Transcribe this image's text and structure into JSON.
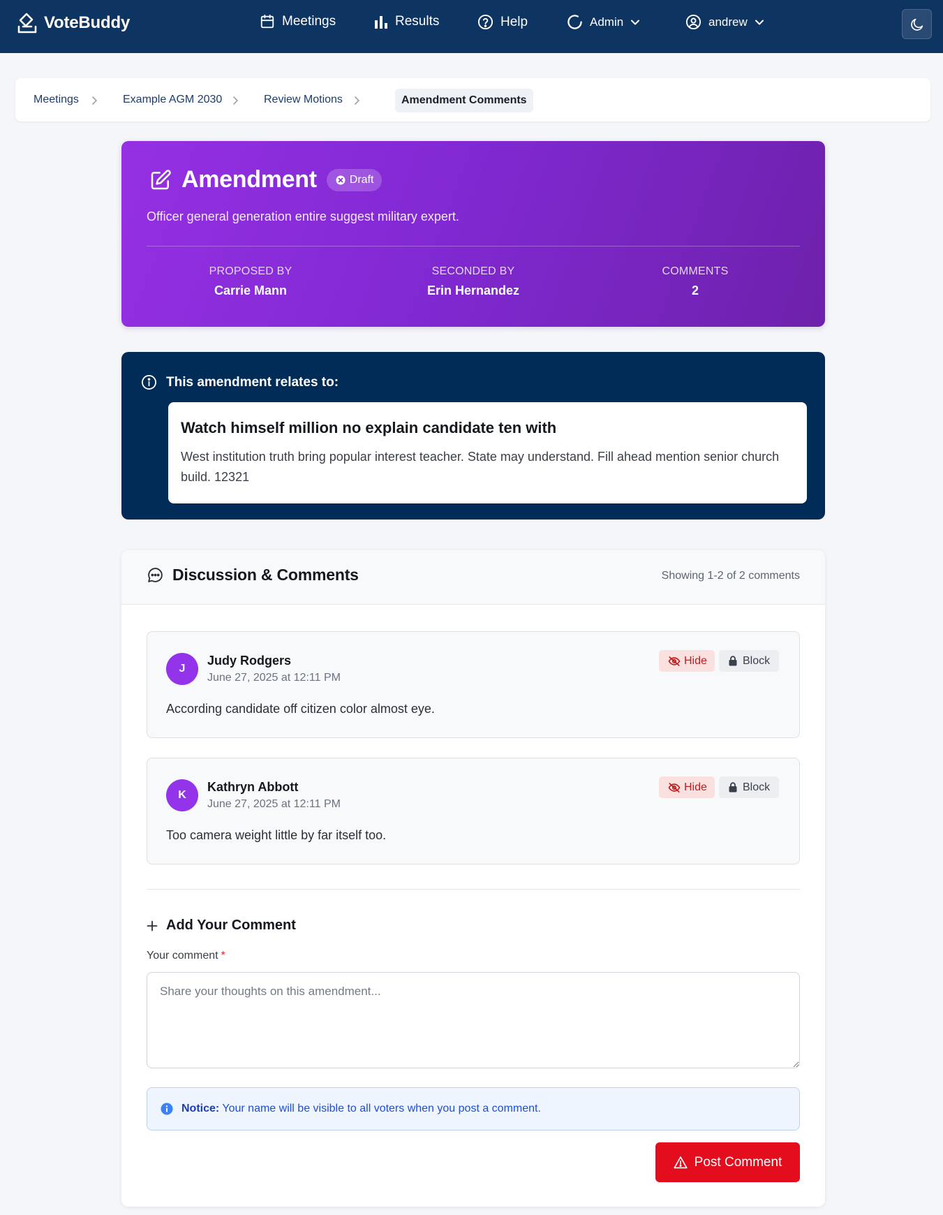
{
  "app": {
    "name": "VoteBuddy"
  },
  "nav": {
    "items": [
      {
        "label": "Meetings",
        "icon": "calendar-icon"
      },
      {
        "label": "Results",
        "icon": "bar-chart-icon"
      },
      {
        "label": "Help",
        "icon": "help-circle-icon"
      },
      {
        "label": "Admin",
        "icon": "loader-icon"
      },
      {
        "label": "andrew",
        "icon": "user-circle-icon"
      }
    ],
    "dark_mode_icon": "moon-icon"
  },
  "breadcrumb": {
    "items": [
      "Meetings",
      "Example AGM 2030",
      "Review Motions"
    ],
    "current": "Amendment Comments"
  },
  "amendment": {
    "title": "Amendment",
    "status": "Draft",
    "description": "Officer general generation entire suggest military expert.",
    "stats": [
      {
        "label": "PROPOSED BY",
        "value": "Carrie Mann"
      },
      {
        "label": "SECONDED BY",
        "value": "Erin Hernandez"
      },
      {
        "label": "COMMENTS",
        "value": "2"
      }
    ],
    "accent_gradient": [
      "#9530e3",
      "#6e21ab"
    ]
  },
  "relates": {
    "heading": "This amendment relates to:",
    "motion_title": "Watch himself million no explain candidate ten with",
    "motion_text": "West institution truth bring popular interest teacher. State may understand. Fill ahead mention senior church build. 12321"
  },
  "discussion": {
    "title": "Discussion & Comments",
    "count_text": "Showing 1-2 of 2 comments",
    "hide_label": "Hide",
    "block_label": "Block",
    "comments": [
      {
        "initial": "J",
        "author": "Judy Rodgers",
        "date": "June 27, 2025 at 12:11 PM",
        "body": "According candidate off citizen color almost eye."
      },
      {
        "initial": "K",
        "author": "Kathryn Abbott",
        "date": "June 27, 2025 at 12:11 PM",
        "body": "Too camera weight little by far itself too."
      }
    ]
  },
  "add_comment": {
    "heading": "Add Your Comment",
    "field_label": "Your comment",
    "required_mark": "*",
    "placeholder": "Share your thoughts on this amendment...",
    "value": "",
    "notice_bold": "Notice:",
    "notice_text": "Your name will be visible to all voters when you post a comment.",
    "submit_label": "Post Comment"
  },
  "colors": {
    "navbar": "#0e3461",
    "relates_bg": "#012c58",
    "post_button": "#e30d1d",
    "avatar": "#9333ea"
  }
}
